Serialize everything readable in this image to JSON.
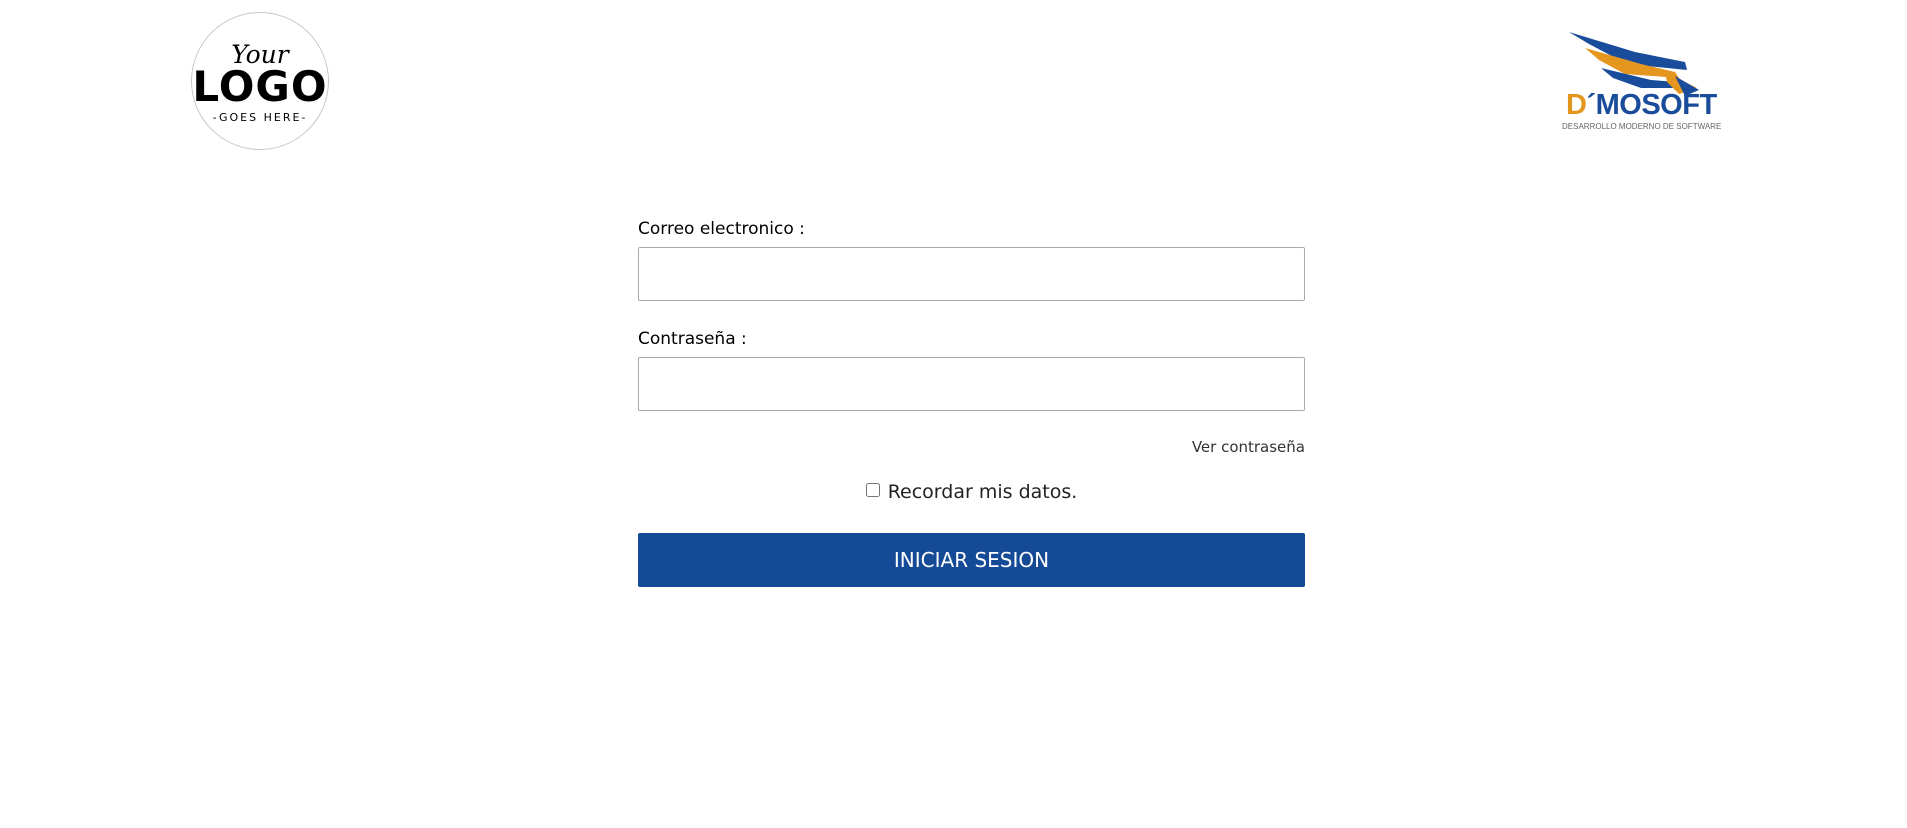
{
  "logos": {
    "left": {
      "line1": "Your",
      "line2": "LOGO",
      "line3": "-GOES HERE-"
    },
    "right": {
      "brand_d": "D",
      "brand_rest": "´MOSOFT",
      "tagline": "DESARROLLO MODERNO DE SOFTWARE",
      "colors": {
        "orange": "#e4961f",
        "blue": "#1a4c9c"
      },
      "icon": "wings-icon"
    }
  },
  "form": {
    "email_label": "Correo electronico :",
    "email_value": "",
    "password_label": "Contraseña :",
    "password_value": "",
    "show_password_link": "Ver contraseña",
    "remember_label": "Recordar mis datos.",
    "remember_checked": false,
    "submit_label": "INICIAR SESION",
    "submit_color": "#144a96"
  }
}
